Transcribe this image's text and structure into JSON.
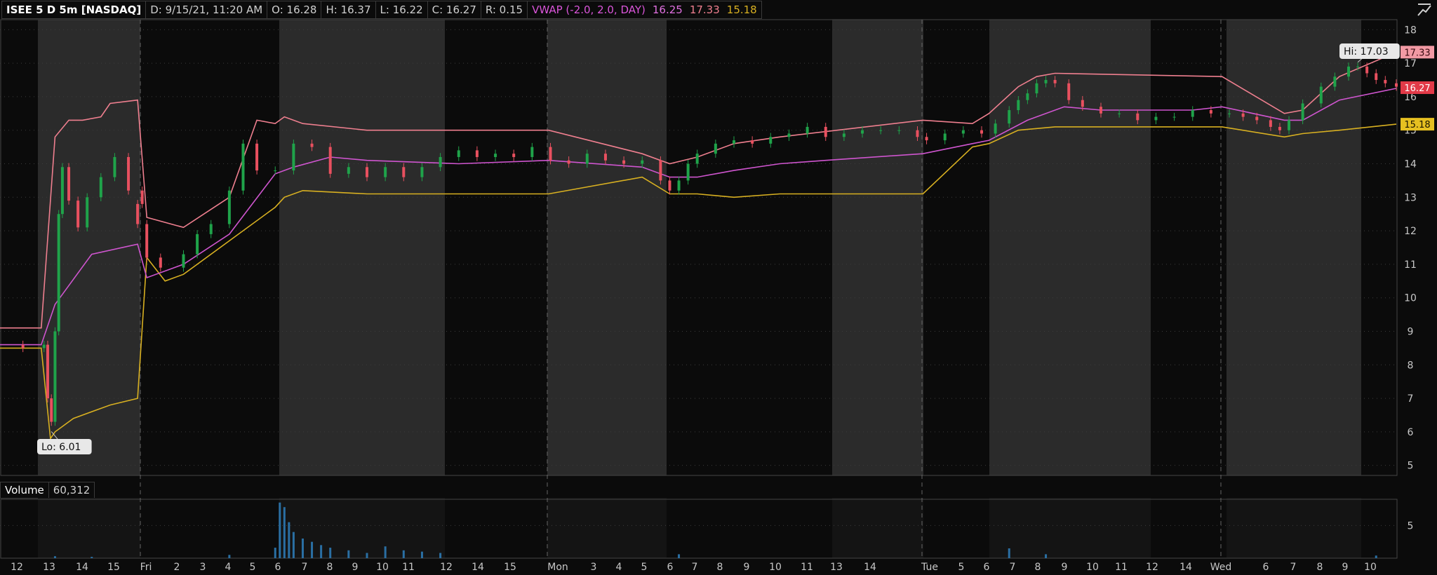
{
  "header": {
    "symbol": "ISEE 5 D 5m [NASDAQ]",
    "date": "D: 9/15/21, 11:20 AM",
    "open": "O: 16.28",
    "high": "H: 16.37",
    "low": "L: 16.22",
    "close": "C: 16.27",
    "range": "R: 0.15",
    "study_name": "VWAP (-2.0, 2.0, DAY)",
    "study_vwap": "16.25",
    "study_upper": "17.33",
    "study_lower": "15.18"
  },
  "volume_header": {
    "label": "Volume",
    "value": "60,312"
  },
  "price_tags": {
    "upper": "17.33",
    "last": "16.27",
    "lower": "15.18"
  },
  "annotations": {
    "hi": "Hi: 17.03",
    "lo": "Lo: 6.01"
  },
  "colors": {
    "background": "#0b0b0b",
    "session_shade": "#2b2b2b",
    "vwap": "#cf55cf",
    "upper_band": "#ef7f8f",
    "lower_band": "#d8b021",
    "candle_up": "#1fa34a",
    "candle_down": "#e8505f",
    "volume": "#2a6fa3",
    "grid": "#3c3c3c"
  },
  "icons": {
    "chart_settings": "chart-toggle-icon"
  },
  "chart_data": [
    {
      "type": "line",
      "title": "ISEE 5 D 5m [NASDAQ]",
      "ylim": [
        4.7,
        18.3
      ],
      "y_ticks": [
        5,
        6,
        7,
        8,
        9,
        10,
        11,
        12,
        13,
        14,
        15,
        16,
        17,
        18
      ],
      "x_tick_labels": [
        "12",
        "13",
        "14",
        "15",
        "Fri",
        "2",
        "3",
        "4",
        "5",
        "6",
        "7",
        "8",
        "9",
        "10",
        "11",
        "12",
        "14",
        "15",
        "Mon",
        "3",
        "4",
        "5",
        "6",
        "7",
        "8",
        "9",
        "10",
        "11",
        "13",
        "14",
        "Tue",
        "5",
        "6",
        "7",
        "8",
        "9",
        "10",
        "11",
        "12",
        "14",
        "Wed",
        "6",
        "7",
        "8",
        "9",
        "10"
      ],
      "price": {
        "t": [
          0,
          25,
          48,
          52,
          56,
          60,
          64,
          68,
          75,
          85,
          95,
          110,
          125,
          140,
          155,
          150,
          160,
          175,
          200,
          215,
          230,
          250,
          265,
          280,
          300,
          320,
          340,
          360,
          380,
          400,
          420,
          440,
          460,
          480,
          500,
          520,
          540,
          560,
          580,
          600,
          620,
          640,
          660,
          680,
          700,
          720,
          730,
          740,
          750,
          760,
          780,
          800,
          820,
          840,
          860,
          880,
          900,
          920,
          940,
          960,
          980,
          1000,
          1010,
          1030,
          1050,
          1070,
          1085,
          1100,
          1110,
          1120,
          1130,
          1140,
          1150,
          1165,
          1180,
          1200,
          1220,
          1240,
          1260,
          1280,
          1300,
          1320,
          1340,
          1355,
          1370,
          1385,
          1395,
          1405,
          1420,
          1440,
          1455,
          1470,
          1480,
          1490,
          1500,
          1510,
          1522
        ],
        "close": [
          8.6,
          8.5,
          8.6,
          7.0,
          6.3,
          9.0,
          12.5,
          13.9,
          12.9,
          12.1,
          13.0,
          13.6,
          14.2,
          13.2,
          12.8,
          12.2,
          11.2,
          10.9,
          11.3,
          11.9,
          12.2,
          13.2,
          14.6,
          13.8,
          13.8,
          14.6,
          14.5,
          13.7,
          13.9,
          13.6,
          13.9,
          13.6,
          13.9,
          14.2,
          14.4,
          14.2,
          14.3,
          14.2,
          14.5,
          14.1,
          14.0,
          14.3,
          14.1,
          14.0,
          14.1,
          13.5,
          13.2,
          13.5,
          14.0,
          14.3,
          14.6,
          14.7,
          14.6,
          14.8,
          14.9,
          15.1,
          14.8,
          14.9,
          15.0,
          15.0,
          15.0,
          14.8,
          14.7,
          14.9,
          15.0,
          14.9,
          15.2,
          15.6,
          15.9,
          16.1,
          16.4,
          16.5,
          16.4,
          15.9,
          15.7,
          15.5,
          15.5,
          15.3,
          15.4,
          15.4,
          15.6,
          15.5,
          15.5,
          15.4,
          15.3,
          15.1,
          15.0,
          15.3,
          15.8,
          16.3,
          16.6,
          16.9,
          16.9,
          16.7,
          16.5,
          16.4,
          16.3
        ]
      },
      "vwap": {
        "t": [
          0,
          45,
          60,
          100,
          150,
          160,
          200,
          250,
          300,
          320,
          360,
          400,
          500,
          598,
          700,
          730,
          760,
          800,
          850,
          900,
          1006,
          1060,
          1078,
          1120,
          1160,
          1200,
          1300,
          1332,
          1400,
          1420,
          1460,
          1522
        ],
        "y": [
          8.6,
          8.6,
          9.8,
          11.3,
          11.6,
          10.6,
          11.0,
          11.9,
          13.7,
          13.9,
          14.2,
          14.1,
          14.0,
          14.1,
          13.9,
          13.6,
          13.6,
          13.8,
          14.0,
          14.1,
          14.3,
          14.6,
          14.7,
          15.3,
          15.7,
          15.6,
          15.6,
          15.7,
          15.3,
          15.3,
          15.9,
          16.25
        ]
      },
      "upper": {
        "t": [
          0,
          45,
          60,
          75,
          90,
          110,
          120,
          150,
          160,
          200,
          250,
          280,
          300,
          310,
          330,
          400,
          500,
          598,
          700,
          730,
          760,
          800,
          850,
          1006,
          1060,
          1078,
          1110,
          1130,
          1150,
          1332,
          1400,
          1420,
          1460,
          1522
        ],
        "y": [
          9.1,
          9.1,
          14.8,
          15.3,
          15.3,
          15.4,
          15.8,
          15.9,
          12.4,
          12.1,
          13.0,
          15.3,
          15.2,
          15.4,
          15.2,
          15.0,
          15.0,
          15.0,
          14.3,
          14.0,
          14.2,
          14.6,
          14.8,
          15.3,
          15.2,
          15.5,
          16.3,
          16.6,
          16.7,
          16.6,
          15.5,
          15.6,
          16.6,
          17.33
        ]
      },
      "lower": {
        "t": [
          0,
          45,
          55,
          60,
          80,
          120,
          150,
          160,
          180,
          200,
          250,
          300,
          310,
          330,
          400,
          500,
          598,
          700,
          730,
          760,
          800,
          850,
          1006,
          1060,
          1078,
          1110,
          1150,
          1332,
          1400,
          1420,
          1460,
          1522
        ],
        "y": [
          8.5,
          8.5,
          5.8,
          6.0,
          6.4,
          6.8,
          7.0,
          11.2,
          10.5,
          10.7,
          11.7,
          12.7,
          13.0,
          13.2,
          13.1,
          13.1,
          13.1,
          13.6,
          13.1,
          13.1,
          13.0,
          13.1,
          13.1,
          14.5,
          14.6,
          15.0,
          15.1,
          15.1,
          14.8,
          14.9,
          15.0,
          15.18
        ]
      },
      "annotations": [
        {
          "text": "Hi: 17.03",
          "value": 17.03
        },
        {
          "text": "Lo: 6.01",
          "value": 6.01
        }
      ]
    },
    {
      "type": "bar",
      "title": "Volume",
      "ylim": [
        0,
        9
      ],
      "y_ticks": [
        5
      ],
      "series": [
        {
          "name": "Volume",
          "t": [
            60,
            100,
            250,
            300,
            305,
            310,
            315,
            320,
            330,
            340,
            350,
            360,
            380,
            400,
            420,
            440,
            460,
            480,
            740,
            1100,
            1140,
            1500
          ],
          "values": [
            0.3,
            0.2,
            0.5,
            1.6,
            8.5,
            7.8,
            5.5,
            4.0,
            3.0,
            2.5,
            2.0,
            1.6,
            1.2,
            0.8,
            1.8,
            1.2,
            1.0,
            0.8,
            0.6,
            1.5,
            0.6,
            0.4
          ]
        }
      ]
    }
  ]
}
